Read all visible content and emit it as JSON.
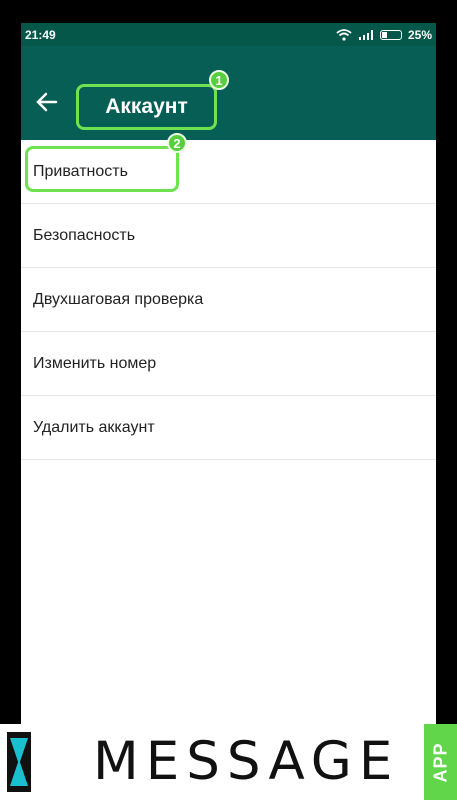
{
  "status": {
    "time": "21:49",
    "battery_percent": "25%",
    "icons": [
      "wifi-icon",
      "signal-icon",
      "battery-icon"
    ]
  },
  "toolbar": {
    "title": "Аккаунт",
    "back_icon": "arrow-left-icon",
    "annotation_badge": "1"
  },
  "menu": {
    "items": [
      {
        "label": "Приватность"
      },
      {
        "label": "Безопасность"
      },
      {
        "label": "Двухшаговая проверка"
      },
      {
        "label": "Изменить номер"
      },
      {
        "label": "Удалить аккаунт"
      }
    ],
    "annotation_badge": "2"
  },
  "watermark": {
    "text": "MESSAGE",
    "app_label": "APP"
  },
  "colors": {
    "toolbar": "#075e54",
    "statusbar": "#05574a",
    "highlight": "#6ee24f"
  }
}
